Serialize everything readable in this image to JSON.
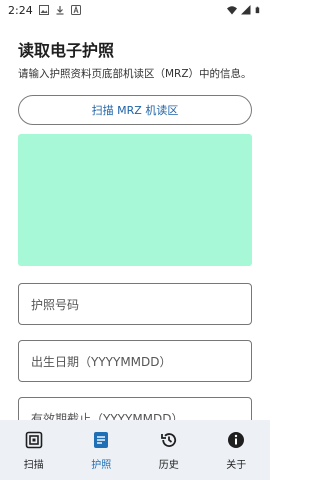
{
  "status_bar": {
    "time": "2:24",
    "icons": [
      "image-icon",
      "download-icon",
      "font-icon",
      "wifi-icon",
      "signal-icon",
      "battery-icon"
    ]
  },
  "page": {
    "title": "读取电子护照",
    "subtitle": "请输入护照资料页底部机读区（MRZ）中的信息。",
    "scan_button_label": "扫描 MRZ 机读区"
  },
  "form": {
    "passport_number_placeholder": "护照号码",
    "birth_date_placeholder": "出生日期（YYYYMMDD）",
    "expiry_date_placeholder": "有效期截止（YYYYMMDD）"
  },
  "bottom_nav": {
    "items": [
      {
        "label": "扫描",
        "icon": "scan-icon",
        "active": false
      },
      {
        "label": "护照",
        "icon": "passport-icon",
        "active": true
      },
      {
        "label": "历史",
        "icon": "history-icon",
        "active": false
      },
      {
        "label": "关于",
        "icon": "info-icon",
        "active": false
      }
    ]
  },
  "colors": {
    "accent": "#1f6fb6",
    "preview_fill": "#a7f8d6",
    "nav_background": "#edf1f6"
  }
}
